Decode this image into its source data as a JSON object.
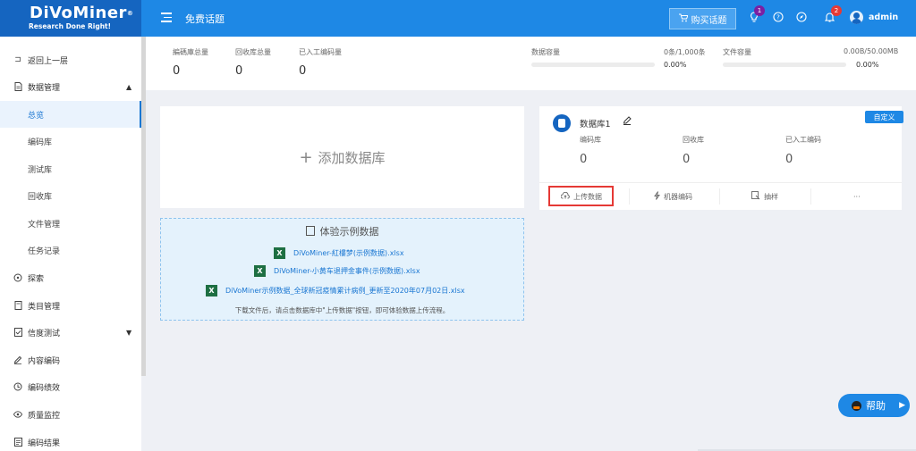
{
  "header": {
    "logo": "DiVoMiner",
    "logo_tagline": "Research Done Right!",
    "title": "免费话题",
    "buy_button": "购买话题",
    "badge_bulb": "1",
    "badge_bell": "2",
    "username": "admin",
    "icons": [
      "menu-icon",
      "cart-icon",
      "bulb-icon",
      "help-circle-icon",
      "compass-icon",
      "bell-icon",
      "avatar"
    ]
  },
  "sidebar": {
    "items": [
      {
        "label": "返回上一层",
        "icon": "back-icon"
      },
      {
        "label": "数据管理",
        "icon": "document-icon",
        "expanded": true
      },
      {
        "label": "总览",
        "active": true
      },
      {
        "label": "编码库"
      },
      {
        "label": "测试库"
      },
      {
        "label": "回收库"
      },
      {
        "label": "文件管理"
      },
      {
        "label": "任务记录"
      },
      {
        "label": "探索",
        "icon": "explore-icon"
      },
      {
        "label": "类目管理",
        "icon": "category-icon"
      },
      {
        "label": "信度测试",
        "icon": "reliability-icon",
        "expandable": true
      },
      {
        "label": "内容编码",
        "icon": "edit-icon"
      },
      {
        "label": "编码绩效",
        "icon": "performance-icon"
      },
      {
        "label": "质量监控",
        "icon": "eye-icon"
      },
      {
        "label": "编码结果",
        "icon": "result-icon"
      }
    ]
  },
  "stats": {
    "coding_total_label": "編碼庫总量",
    "coding_total_value": "0",
    "recycle_total_label": "回收库总量",
    "recycle_total_value": "0",
    "manual_label": "已入工编码量",
    "manual_value": "0",
    "data_capacity_label": "数据容量",
    "data_capacity_amount": "0条/1,000条",
    "data_capacity_percent": "0.00%",
    "data_capacity_fill": 0,
    "file_capacity_label": "文件容量",
    "file_capacity_amount": "0.00B/50.00MB",
    "file_capacity_percent": "0.00%",
    "file_capacity_fill": 0
  },
  "add_database": "添加数据库",
  "demo": {
    "title": "体验示例数据",
    "files": [
      "DiVoMiner-紅樓梦(示例数据).xlsx",
      "DiVoMiner-小黄车退押金事件(示例数据).xlsx",
      "DiVoMiner示例数据_全球新冠疫情累计病例_更新至2020年07月02日.xlsx"
    ],
    "note": "下载文件后，请点击数据库中\"上传数据\"按钮，即可体验数据上传流程。"
  },
  "database": {
    "name": "数据库1",
    "custom_tag": "自定义",
    "coding_label": "编码库",
    "coding_value": "0",
    "recycle_label": "回收库",
    "recycle_value": "0",
    "manual_label": "已入工编码",
    "manual_value": "0",
    "actions": {
      "upload": "上传数据",
      "machine": "机器编码",
      "sample": "抽样",
      "more": "···"
    }
  },
  "help": "帮助",
  "colors": {
    "header": "#1e88e5",
    "logo_bg": "#1565c0",
    "active": "#1976d2",
    "highlight": "#e53935",
    "excel": "#1d6f42"
  }
}
